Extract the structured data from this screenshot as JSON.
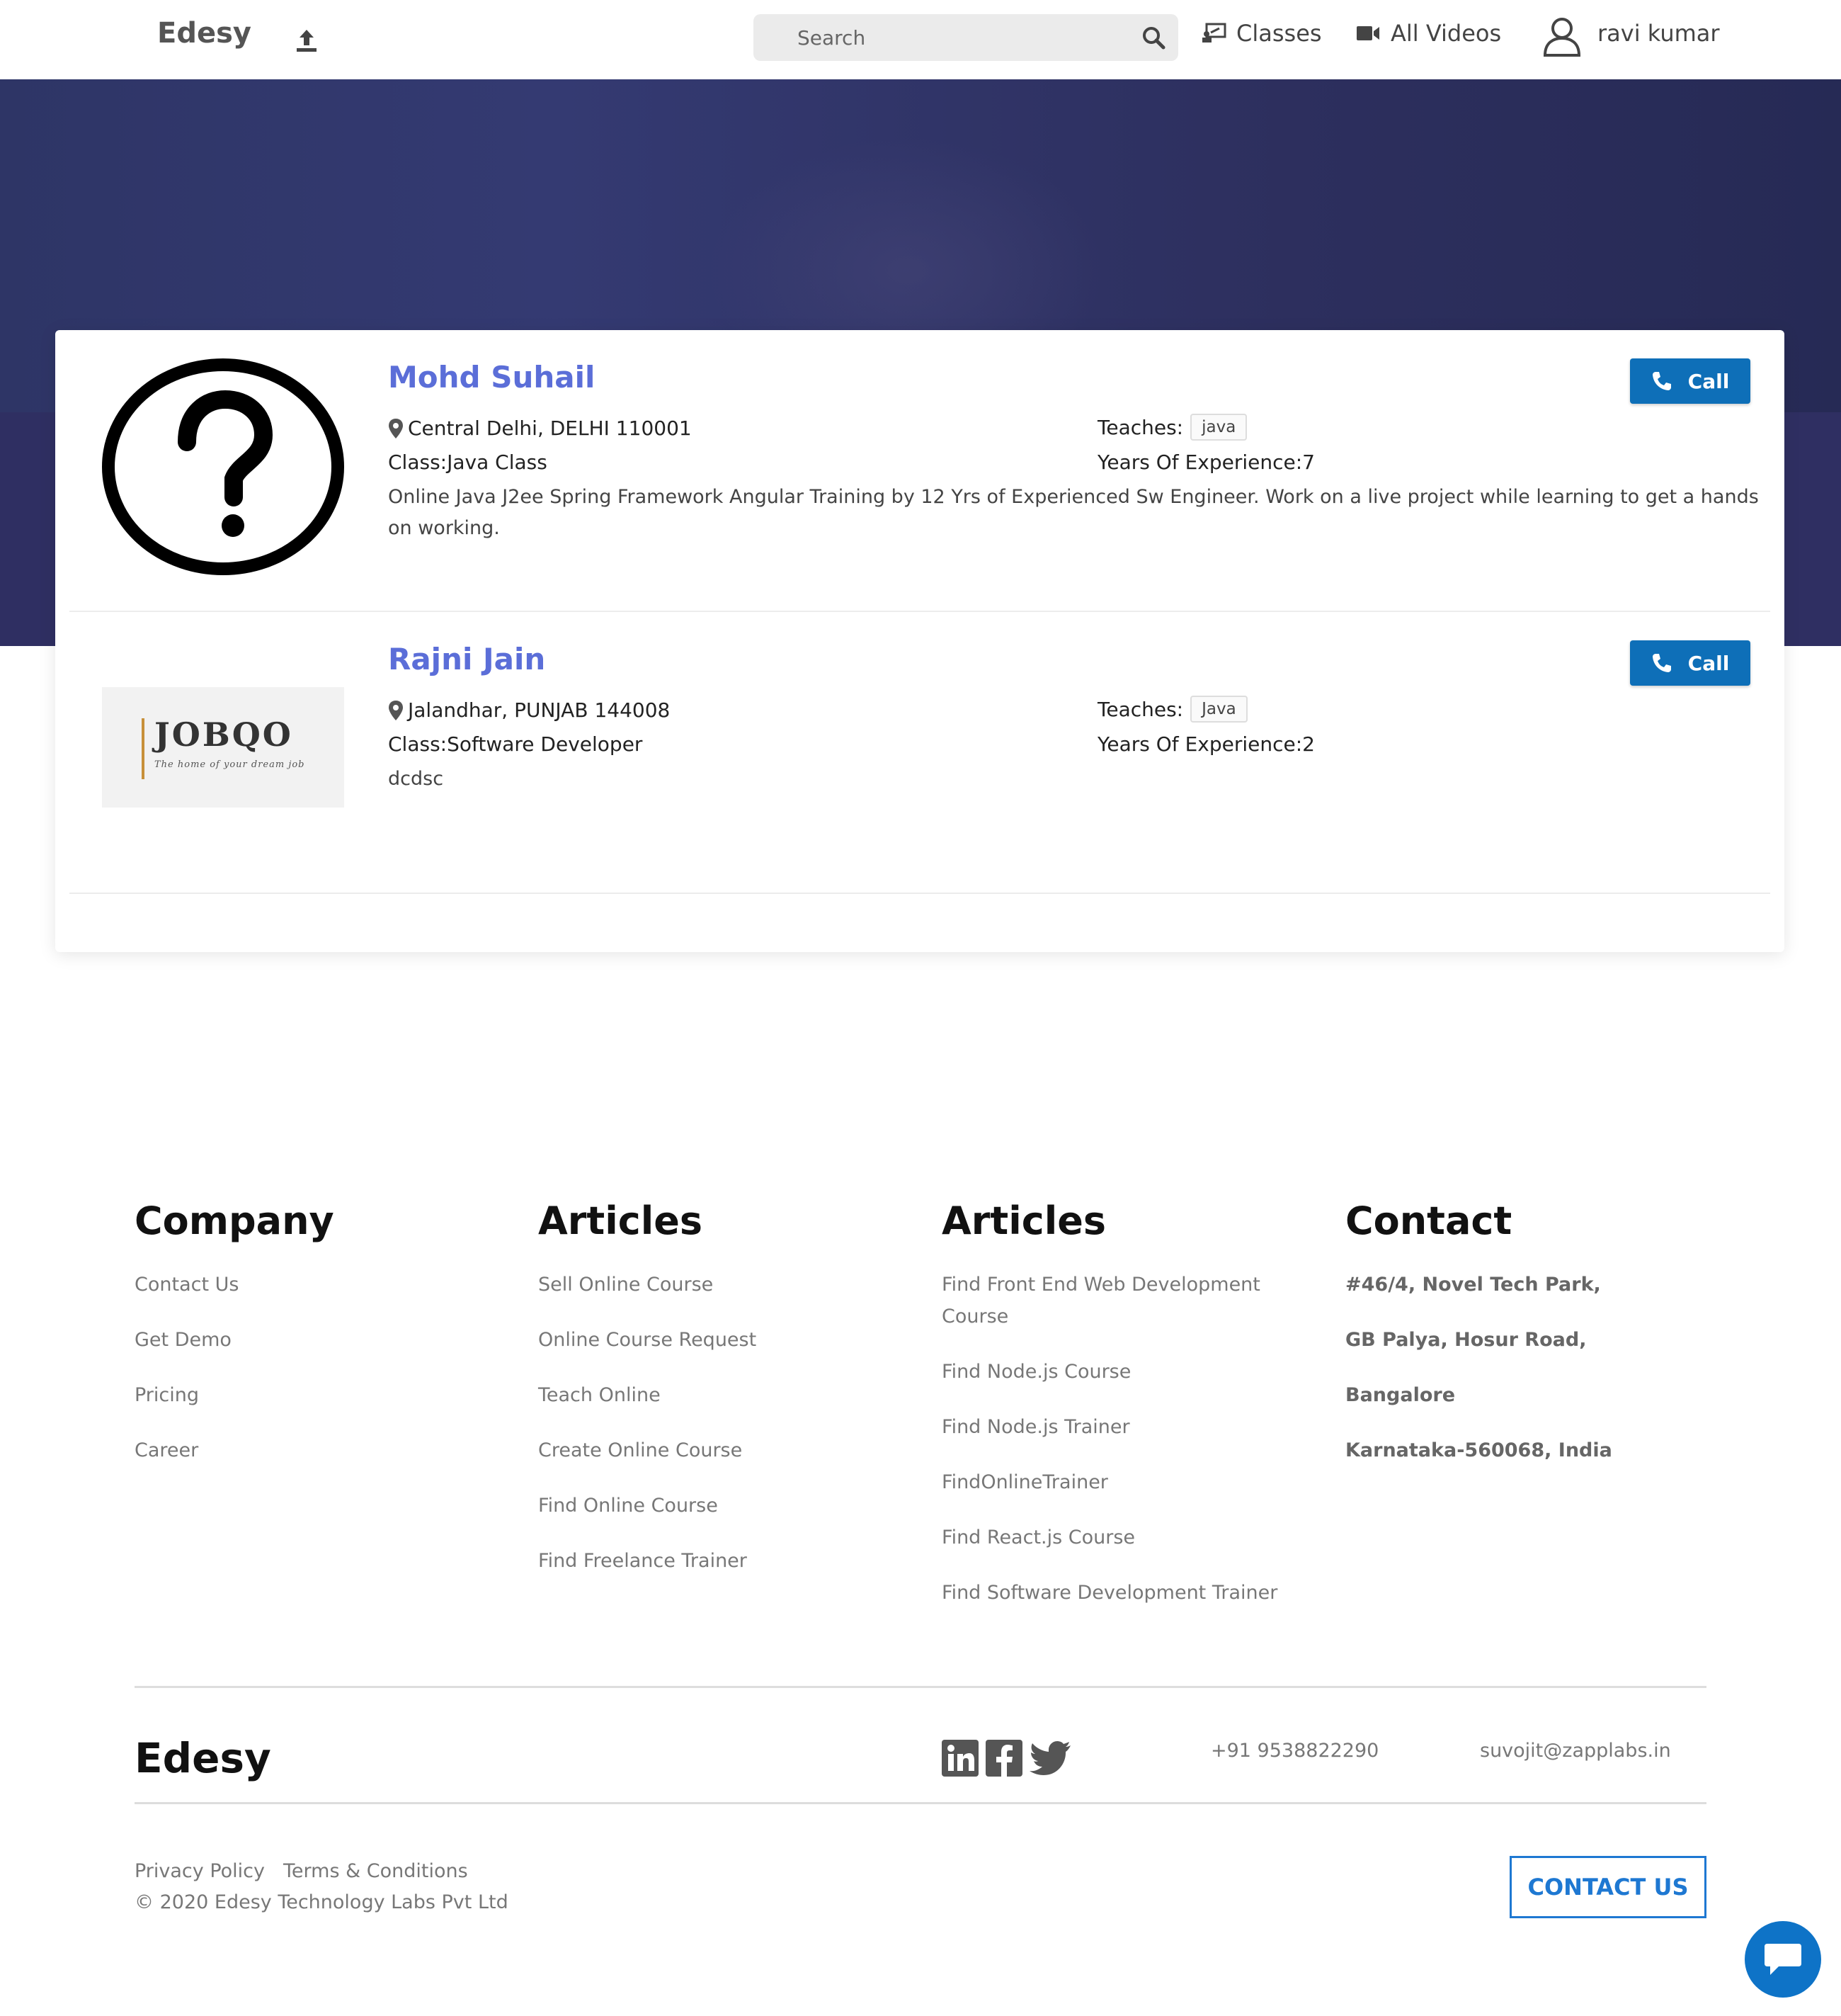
{
  "header": {
    "brand": "Edesy",
    "search_placeholder": "Search",
    "nav": [
      {
        "label": "Classes",
        "icon": "classroom-icon"
      },
      {
        "label": "All Videos",
        "icon": "video-camera-icon"
      }
    ],
    "user_name": "ravi kumar"
  },
  "tutors": [
    {
      "name": "Mohd Suhail",
      "location": "Central Delhi, DELHI 110001",
      "class": "Class:Java Class",
      "description": "Online Java J2ee Spring Framework Angular Training by 12 Yrs of Experienced Sw Engineer. Work on a live project while learning to get a hands on working.",
      "teaches_label": "Teaches:",
      "teaches_tag": "java",
      "experience": "Years Of Experience:7",
      "call_label": "Call",
      "avatar": "question-mark-avatar"
    },
    {
      "name": "Rajni Jain",
      "location": "Jalandhar, PUNJAB 144008",
      "class": "Class:Software Developer",
      "description": "dcdsc",
      "teaches_label": "Teaches:",
      "teaches_tag": "Java",
      "experience": "Years Of Experience:2",
      "call_label": "Call",
      "avatar_logo": {
        "title": "JOBQO",
        "tagline": "The home of your dream job"
      }
    }
  ],
  "footer": {
    "columns": [
      {
        "heading": "Company",
        "links": [
          "Contact Us",
          "Get Demo",
          "Pricing",
          "Career"
        ]
      },
      {
        "heading": "Articles",
        "links": [
          "Sell Online Course",
          "Online Course Request",
          "Teach Online",
          "Create Online Course",
          "Find Online Course",
          "Find Freelance Trainer"
        ]
      },
      {
        "heading": "Articles",
        "links": [
          "Find Front End Web Development Course",
          "Find Node.js Course",
          "Find Node.js Trainer",
          "FindOnlineTrainer",
          "Find React.js Course",
          "Find Software Development Trainer"
        ]
      },
      {
        "heading": "Contact",
        "address": {
          "line1_prefix": "#46/4, ",
          "line1_bold": "Novel Tech Park,",
          "line2": "GB Palya, Hosur Road,",
          "line3": "Bangalore",
          "line4": "Karnataka-560068, India"
        }
      }
    ],
    "brand": "Edesy",
    "social": [
      "linkedin-icon",
      "facebook-icon",
      "twitter-icon"
    ],
    "phone": "+91 9538822290",
    "email": "suvojit@zapplabs.in",
    "privacy": "Privacy Policy",
    "terms": "Terms & Conditions",
    "copyright": "© 2020 Edesy Technology Labs Pvt Ltd",
    "contact_button": "CONTACT US"
  },
  "colors": {
    "accent_name": "#5b6ed8",
    "call_button": "#0e6fb8",
    "contact_button": "#1e78d2",
    "hero_bg": "#2e3566"
  }
}
